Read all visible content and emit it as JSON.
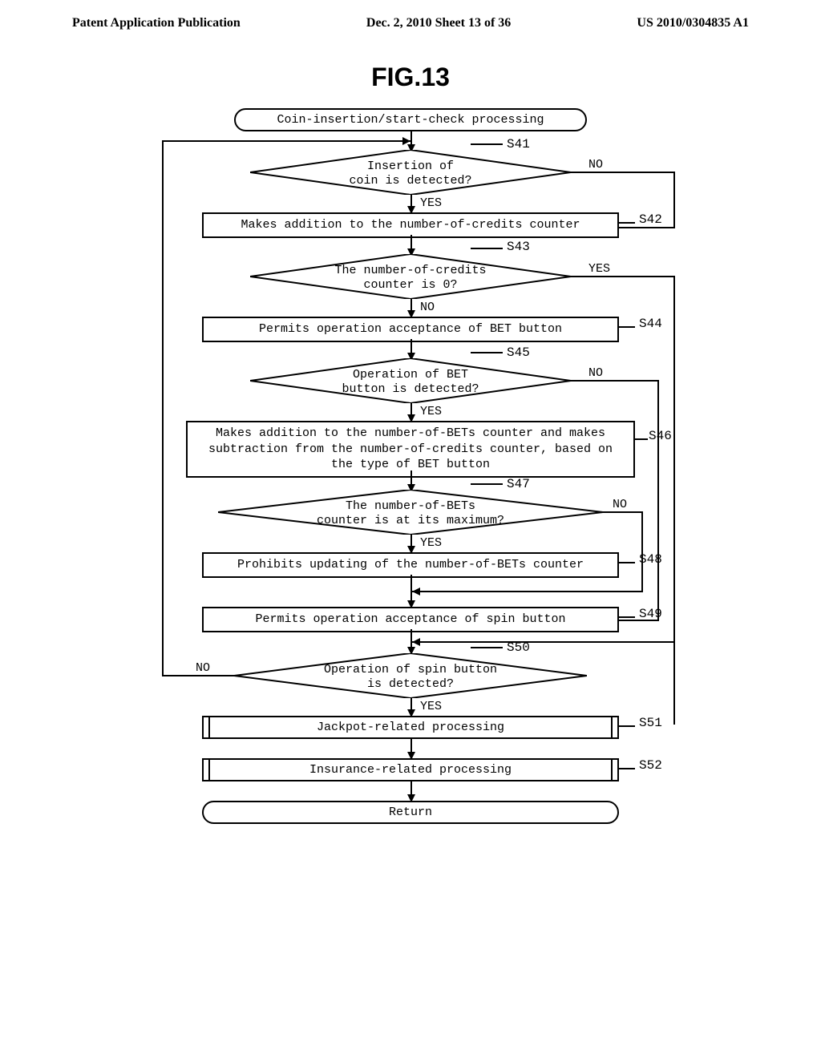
{
  "header": {
    "left": "Patent Application Publication",
    "center": "Dec. 2, 2010  Sheet 13 of 36",
    "right": "US 2010/0304835 A1"
  },
  "figure_title": "FIG.13",
  "flowchart": {
    "start": "Coin-insertion/start-check processing",
    "s41": {
      "text": "Insertion of\ncoin is detected?",
      "label": "S41",
      "yes": "YES",
      "no": "NO"
    },
    "s42": {
      "text": "Makes addition to the number-of-credits counter",
      "label": "S42"
    },
    "s43": {
      "text": "The number-of-credits\ncounter is 0?",
      "label": "S43",
      "yes": "YES",
      "no": "NO"
    },
    "s44": {
      "text": "Permits operation acceptance of BET button",
      "label": "S44"
    },
    "s45": {
      "text": "Operation of BET\nbutton is detected?",
      "label": "S45",
      "yes": "YES",
      "no": "NO"
    },
    "s46": {
      "text": "Makes addition to the number-of-BETs counter and\nmakes subtraction from the number-of-credits counter,\nbased on the type of BET button",
      "label": "S46"
    },
    "s47": {
      "text": "The number-of-BETs\ncounter is at its maximum?",
      "label": "S47",
      "yes": "YES",
      "no": "NO"
    },
    "s48": {
      "text": "Prohibits updating of the number-of-BETs counter",
      "label": "S48"
    },
    "s49": {
      "text": "Permits operation acceptance of spin button",
      "label": "S49"
    },
    "s50": {
      "text": "Operation of spin button\nis detected?",
      "label": "S50",
      "yes": "YES",
      "no": "NO"
    },
    "s51": {
      "text": "Jackpot-related processing",
      "label": "S51"
    },
    "s52": {
      "text": "Insurance-related processing",
      "label": "S52"
    },
    "return": "Return"
  }
}
